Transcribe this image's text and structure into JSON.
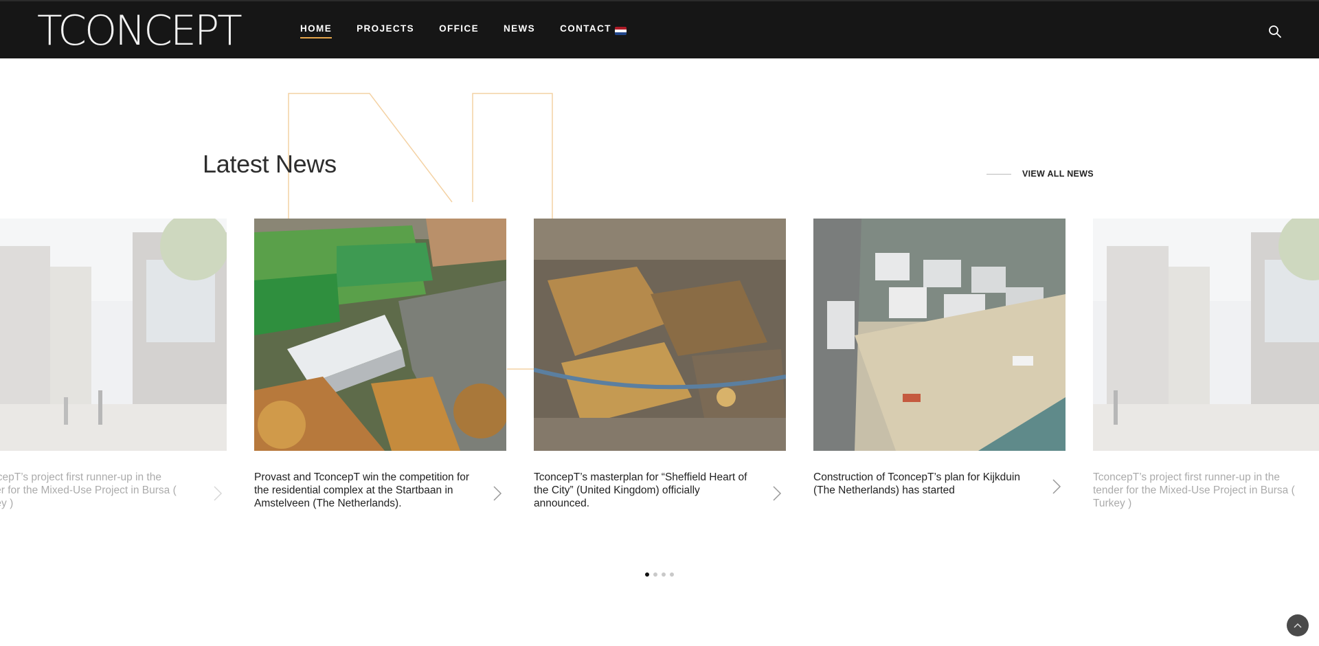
{
  "header": {
    "logo_text": "TCONCEPT",
    "nav": [
      {
        "label": "HOME",
        "active": true
      },
      {
        "label": "PROJECTS",
        "active": false
      },
      {
        "label": "OFFICE",
        "active": false
      },
      {
        "label": "NEWS",
        "active": false
      },
      {
        "label": "CONTACT",
        "active": false
      }
    ],
    "language_flag": "netherlands-flag-icon",
    "search_icon": "search-icon",
    "accent_color": "#e8a74c"
  },
  "news": {
    "title": "Latest News",
    "view_all_label": "VIEW ALL NEWS",
    "cards": [
      {
        "title": "TconcepT’s project first runner-up in the tender for the Mixed-Use Project in Bursa ( Turkey )",
        "image": "street-rendering",
        "faded": true
      },
      {
        "title": "Provast and TconcepT win the competition for the residential complex at the Startbaan in Amstelveen (The Netherlands).",
        "image": "aerial-sports-fields",
        "faded": false
      },
      {
        "title": "TconcepT’s masterplan for “Sheffield Heart of the City” (United Kingdom) officially announced.",
        "image": "aerial-city-center",
        "faded": false
      },
      {
        "title": "Construction of TconcepT’s plan for Kijkduin (The Netherlands) has started",
        "image": "aerial-beach",
        "faded": false
      },
      {
        "title": "TconcepT’s project first runner-up in the tender for the Mixed-Use Project in Bursa ( Turkey )",
        "image": "street-rendering",
        "faded": true
      }
    ],
    "pagination": {
      "count": 4,
      "active": 1
    }
  },
  "back_to_top_icon": "chevron-up-icon"
}
